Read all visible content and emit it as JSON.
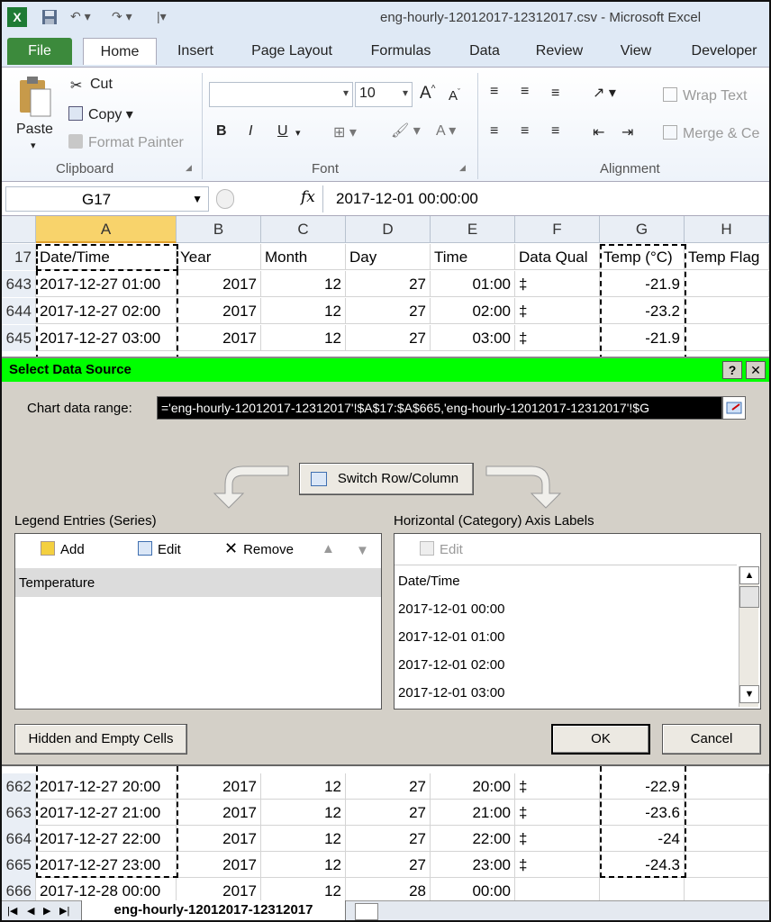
{
  "window": {
    "title": "eng-hourly-12012017-12312017.csv - Microsoft Excel"
  },
  "tabs": [
    "File",
    "Home",
    "Insert",
    "Page Layout",
    "Formulas",
    "Data",
    "Review",
    "View",
    "Developer"
  ],
  "ribbon": {
    "clipboard": {
      "paste": "Paste",
      "cut": "Cut",
      "copy": "Copy",
      "format_painter": "Format Painter",
      "label": "Clipboard"
    },
    "font": {
      "size": "10",
      "label": "Font",
      "bold": "B",
      "italic": "I",
      "underline": "U"
    },
    "alignment": {
      "wrap_text": "Wrap Text",
      "merge": "Merge & Ce",
      "label": "Alignment"
    }
  },
  "formula_bar": {
    "name_box": "G17",
    "fx": "fx",
    "value": "2017-12-01  00:00:00"
  },
  "columns": [
    "A",
    "B",
    "C",
    "D",
    "E",
    "F",
    "G",
    "H"
  ],
  "header_row": {
    "num": "17",
    "cells": [
      "Date/Time",
      "Year",
      "Month",
      "Day",
      "Time",
      "Data Qual",
      "Temp (°C)",
      "Temp Flag"
    ]
  },
  "rows_top": [
    {
      "num": "643",
      "cells": [
        "2017-12-27 01:00",
        "2017",
        "12",
        "27",
        "01:00",
        "‡",
        "-21.9",
        ""
      ]
    },
    {
      "num": "644",
      "cells": [
        "2017-12-27 02:00",
        "2017",
        "12",
        "27",
        "02:00",
        "‡",
        "-23.2",
        ""
      ]
    },
    {
      "num": "645",
      "cells": [
        "2017-12-27 03:00",
        "2017",
        "12",
        "27",
        "03:00",
        "‡",
        "-21.9",
        ""
      ]
    }
  ],
  "rows_bottom": [
    {
      "num": "662",
      "cells": [
        "2017-12-27 20:00",
        "2017",
        "12",
        "27",
        "20:00",
        "‡",
        "-22.9",
        ""
      ]
    },
    {
      "num": "663",
      "cells": [
        "2017-12-27 21:00",
        "2017",
        "12",
        "27",
        "21:00",
        "‡",
        "-23.6",
        ""
      ]
    },
    {
      "num": "664",
      "cells": [
        "2017-12-27 22:00",
        "2017",
        "12",
        "27",
        "22:00",
        "‡",
        "-24",
        ""
      ]
    },
    {
      "num": "665",
      "cells": [
        "2017-12-27 23:00",
        "2017",
        "12",
        "27",
        "23:00",
        "‡",
        "-24.3",
        ""
      ]
    },
    {
      "num": "666",
      "cells": [
        "2017-12-28 00:00",
        "2017",
        "12",
        "28",
        "00:00",
        "",
        "",
        " "
      ]
    }
  ],
  "dialog": {
    "title": "Select Data Source",
    "help": "?",
    "close": "✕",
    "range_label": "Chart data range:",
    "range_value": "='eng-hourly-12012017-12312017'!$A$17:$A$665,'eng-hourly-12012017-12312017'!$G",
    "switch": "Switch Row/Column",
    "legend_label": "Legend Entries (Series)",
    "add": "Add",
    "edit": "Edit",
    "remove": "Remove",
    "series": [
      "Temperature"
    ],
    "axis_label": "Horizontal (Category) Axis Labels",
    "axis_edit": "Edit",
    "axis_items": [
      "Date/Time",
      "2017-12-01 00:00",
      "2017-12-01 01:00",
      "2017-12-01 02:00",
      "2017-12-01 03:00"
    ],
    "hidden": "Hidden and Empty Cells",
    "ok": "OK",
    "cancel": "Cancel"
  },
  "sheet_tab": "eng-hourly-12012017-12312017"
}
